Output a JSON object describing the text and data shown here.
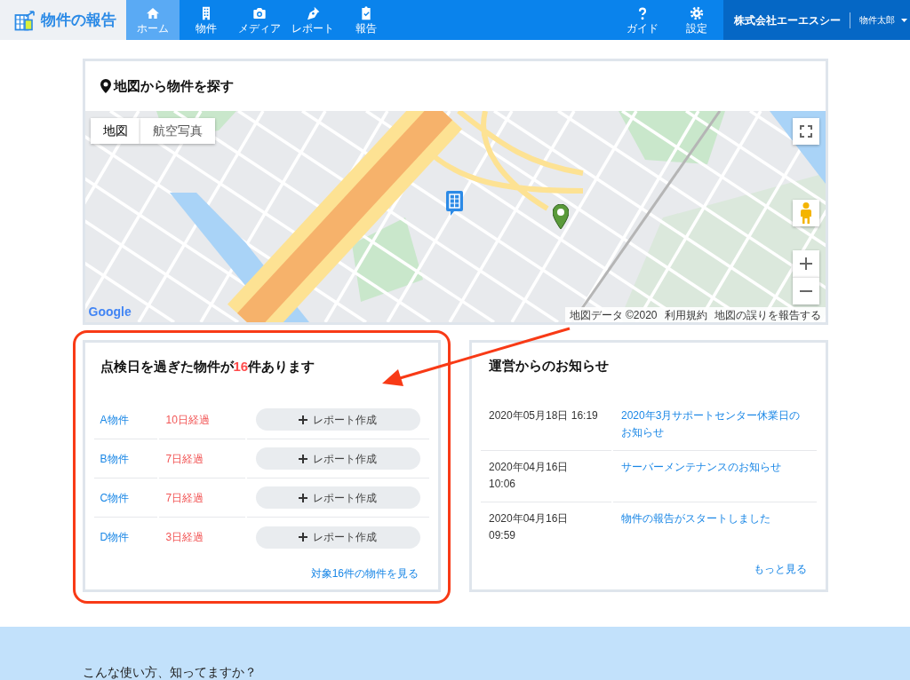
{
  "header": {
    "logo": "物件の報告",
    "nav": [
      {
        "label": "ホーム",
        "selected": true
      },
      {
        "label": "物件",
        "selected": false
      },
      {
        "label": "メディア",
        "selected": false
      },
      {
        "label": "レポート",
        "selected": false
      },
      {
        "label": "報告",
        "selected": false
      }
    ],
    "tools": [
      {
        "label": "ガイド"
      },
      {
        "label": "設定"
      }
    ],
    "company": "株式会社エーエスシー",
    "user": "物件太郎"
  },
  "map_panel": {
    "title": "地図から物件を探す",
    "map_types": [
      {
        "label": "地図",
        "selected": true
      },
      {
        "label": "航空写真",
        "selected": false
      }
    ],
    "markers": [
      {
        "kind": "building"
      },
      {
        "kind": "pin"
      }
    ],
    "logo": "Google",
    "attribution": [
      "地図データ ©2020",
      "利用規約",
      "地図の誤りを報告する"
    ]
  },
  "overdue_panel": {
    "title": "点検日を過ぎた物件が**16**件あります",
    "rows": [
      {
        "name": "A物件",
        "elapsed": "10日経過",
        "action": "レポート作成"
      },
      {
        "name": "B物件",
        "elapsed": "7日経過",
        "action": "レポート作成"
      },
      {
        "name": "C物件",
        "elapsed": "7日経過",
        "action": "レポート作成"
      },
      {
        "name": "D物件",
        "elapsed": "3日経過",
        "action": "レポート作成"
      }
    ],
    "link": "対象16件の物件を見る"
  },
  "notice_panel": {
    "title": "運営からのお知らせ",
    "items": [
      {
        "date": "2020年05月18日 16:19",
        "title": "2020年3月サポートセンター休業日のお知らせ"
      },
      {
        "date": "2020年04月16日\n10:06",
        "title": "サーバーメンテナンスのお知らせ"
      },
      {
        "date": "2020年04月16日\n09:59",
        "title": "物件の報告がスタートしました"
      }
    ],
    "link": "もっと見る"
  },
  "tips_section": {
    "title": "こんな使い方、知ってますか？"
  },
  "annotation": {
    "frame": true,
    "arrow": true
  }
}
